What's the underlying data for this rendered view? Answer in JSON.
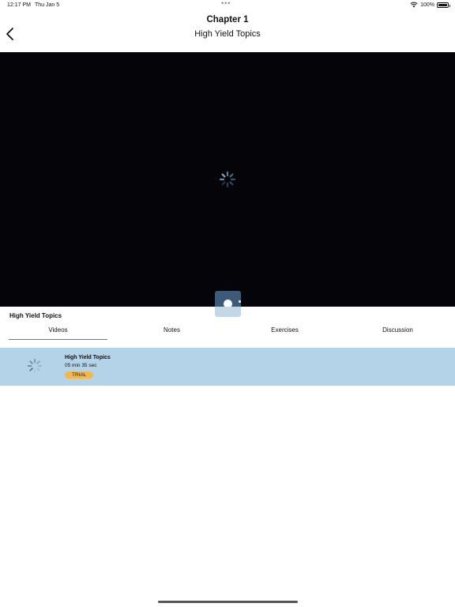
{
  "status_bar": {
    "time": "12:17 PM",
    "date": "Thu Jan 5",
    "dots": "•••",
    "battery": "100%"
  },
  "header": {
    "title": "Chapter 1",
    "subtitle": "High Yield Topics",
    "back_icon": "chevron-left-icon"
  },
  "player": {
    "state": "loading",
    "spinner_icon": "spinner-icon"
  },
  "section": {
    "title": "High Yield Topics",
    "tabs": [
      {
        "label": "Videos",
        "active": true
      },
      {
        "label": "Notes",
        "active": false
      },
      {
        "label": "Exercises",
        "active": false
      },
      {
        "label": "Discussion",
        "active": false
      }
    ]
  },
  "videos": [
    {
      "title": "High Yield Topics",
      "duration": "05 min 35 sec",
      "badge": "TRIAL",
      "selected": true
    }
  ],
  "colors": {
    "accent": "#3d86b8",
    "selected_row": "#b4d3e8",
    "badge": "#f2b84d",
    "player_bg": "#050509"
  }
}
